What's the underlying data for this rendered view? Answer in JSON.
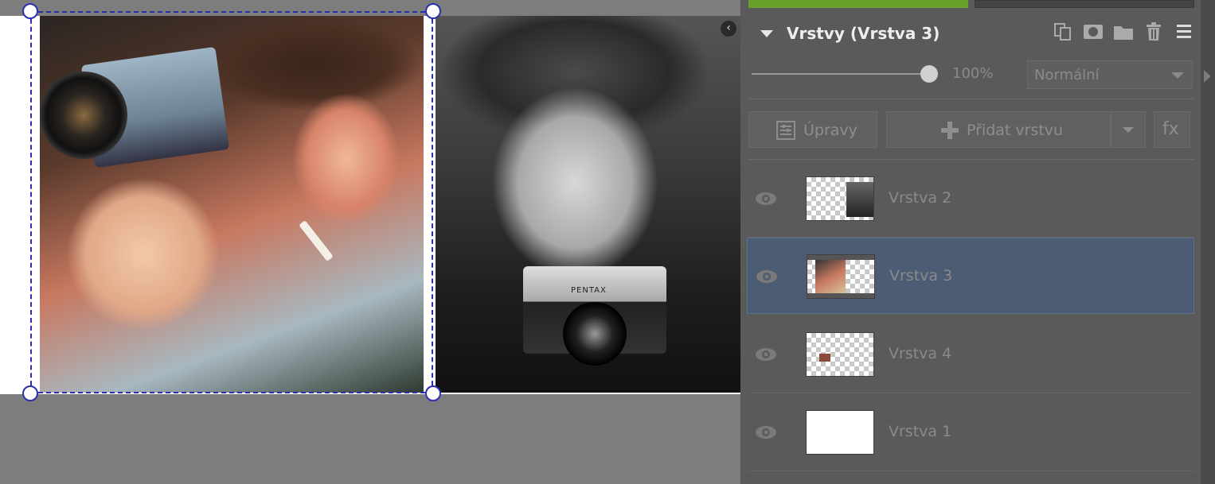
{
  "panel": {
    "title": "Vrstvy (Vrstva 3)",
    "opacity": "100%",
    "blend_mode": "Normální",
    "adjust_label": "Úpravy",
    "add_layer_label": "Přidat vrstvu",
    "fx_label": "fx"
  },
  "canvas": {
    "camera_brand": "PENTAX",
    "collapse_glyph": "‹"
  },
  "layers": [
    {
      "name": "Vrstva 2",
      "selected": false,
      "visible": true
    },
    {
      "name": "Vrstva 3",
      "selected": true,
      "visible": true
    },
    {
      "name": "Vrstva 4",
      "selected": false,
      "visible": true
    },
    {
      "name": "Vrstva 1",
      "selected": false,
      "visible": true
    }
  ],
  "icons": {
    "header": [
      "duplicate-icon",
      "mask-icon",
      "folder-icon",
      "trash-icon",
      "menu-icon"
    ],
    "eye": "eye-icon",
    "adjust": "adjustments-icon",
    "add": "plus-icon"
  },
  "colors": {
    "accent_green": "#6aa12a",
    "selection_blue": "#2b2fb0",
    "selected_row": "#4b5c74"
  }
}
